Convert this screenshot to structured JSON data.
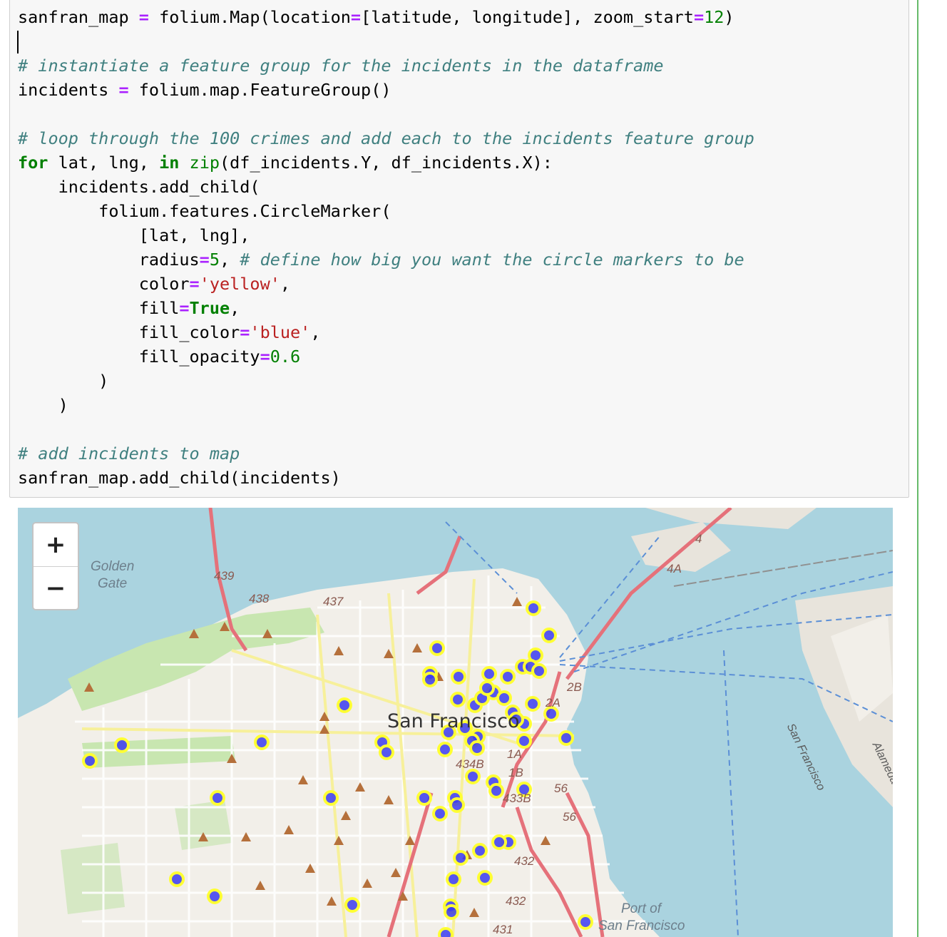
{
  "notebook": {
    "code_lines": [
      [
        {
          "t": "sanfran_map "
        },
        {
          "t": "=",
          "c": "op"
        },
        {
          "t": " folium.Map(location"
        },
        {
          "t": "=",
          "c": "op"
        },
        {
          "t": "[latitude, longitude], zoom_start"
        },
        {
          "t": "=",
          "c": "op"
        },
        {
          "t": "12",
          "c": "num"
        },
        {
          "t": ")"
        }
      ],
      [],
      [
        {
          "t": "# instantiate a feature group for the incidents in the dataframe",
          "c": "cm"
        }
      ],
      [
        {
          "t": "incidents "
        },
        {
          "t": "=",
          "c": "op"
        },
        {
          "t": " folium.map.FeatureGroup()"
        }
      ],
      [],
      [
        {
          "t": "# loop through the 100 crimes and add each to the incidents feature group",
          "c": "cm"
        }
      ],
      [
        {
          "t": "for",
          "c": "kw"
        },
        {
          "t": " lat, lng, "
        },
        {
          "t": "in",
          "c": "kw"
        },
        {
          "t": " "
        },
        {
          "t": "zip",
          "c": "bi"
        },
        {
          "t": "(df_incidents.Y, df_incidents.X):"
        }
      ],
      [
        {
          "t": "    incidents.add_child("
        }
      ],
      [
        {
          "t": "        folium.features.CircleMarker("
        }
      ],
      [
        {
          "t": "            [lat, lng],"
        }
      ],
      [
        {
          "t": "            radius"
        },
        {
          "t": "=",
          "c": "op"
        },
        {
          "t": "5",
          "c": "num"
        },
        {
          "t": ", "
        },
        {
          "t": "# define how big you want the circle markers to be",
          "c": "cm"
        }
      ],
      [
        {
          "t": "            color"
        },
        {
          "t": "=",
          "c": "op"
        },
        {
          "t": "'yellow'",
          "c": "str"
        },
        {
          "t": ","
        }
      ],
      [
        {
          "t": "            fill"
        },
        {
          "t": "=",
          "c": "op"
        },
        {
          "t": "True",
          "c": "kw"
        },
        {
          "t": ","
        }
      ],
      [
        {
          "t": "            fill_color"
        },
        {
          "t": "=",
          "c": "op"
        },
        {
          "t": "'blue'",
          "c": "str"
        },
        {
          "t": ","
        }
      ],
      [
        {
          "t": "            fill_opacity"
        },
        {
          "t": "=",
          "c": "op"
        },
        {
          "t": "0.6",
          "c": "num"
        }
      ],
      [
        {
          "t": "        )"
        }
      ],
      [
        {
          "t": "    )"
        }
      ],
      [],
      [
        {
          "t": "# add incidents to map",
          "c": "cm"
        }
      ],
      [
        {
          "t": "sanfran_map.add_child(incidents)"
        }
      ]
    ]
  },
  "map": {
    "zoom_in_label": "+",
    "zoom_out_label": "−",
    "city_label": "San Francisco",
    "place_labels": {
      "golden": "Golden",
      "gate": "Gate",
      "port_of": "Port of",
      "port_sf": "San Francisco",
      "sf_airport": "San Francisco",
      "alameda": "Alameda"
    },
    "highway_labels": {
      "h439": "439",
      "h438": "438",
      "h437": "437",
      "h4": "4",
      "h4a": "4A",
      "h2b": "2B",
      "h2a": "2A",
      "h1a": "1A",
      "h1b": "1B",
      "h434b": "434B",
      "h433b": "433B",
      "h56a": "56",
      "h56b": "56",
      "h432a": "432",
      "h432b": "432",
      "h431": "431"
    },
    "colors": {
      "water": "#aad3df",
      "land": "#f2efe9",
      "park": "#c8e6b0",
      "marker_stroke": "#ffff33",
      "marker_fill": "#3b3bf0",
      "cell_border": "#66bb6a"
    }
  }
}
